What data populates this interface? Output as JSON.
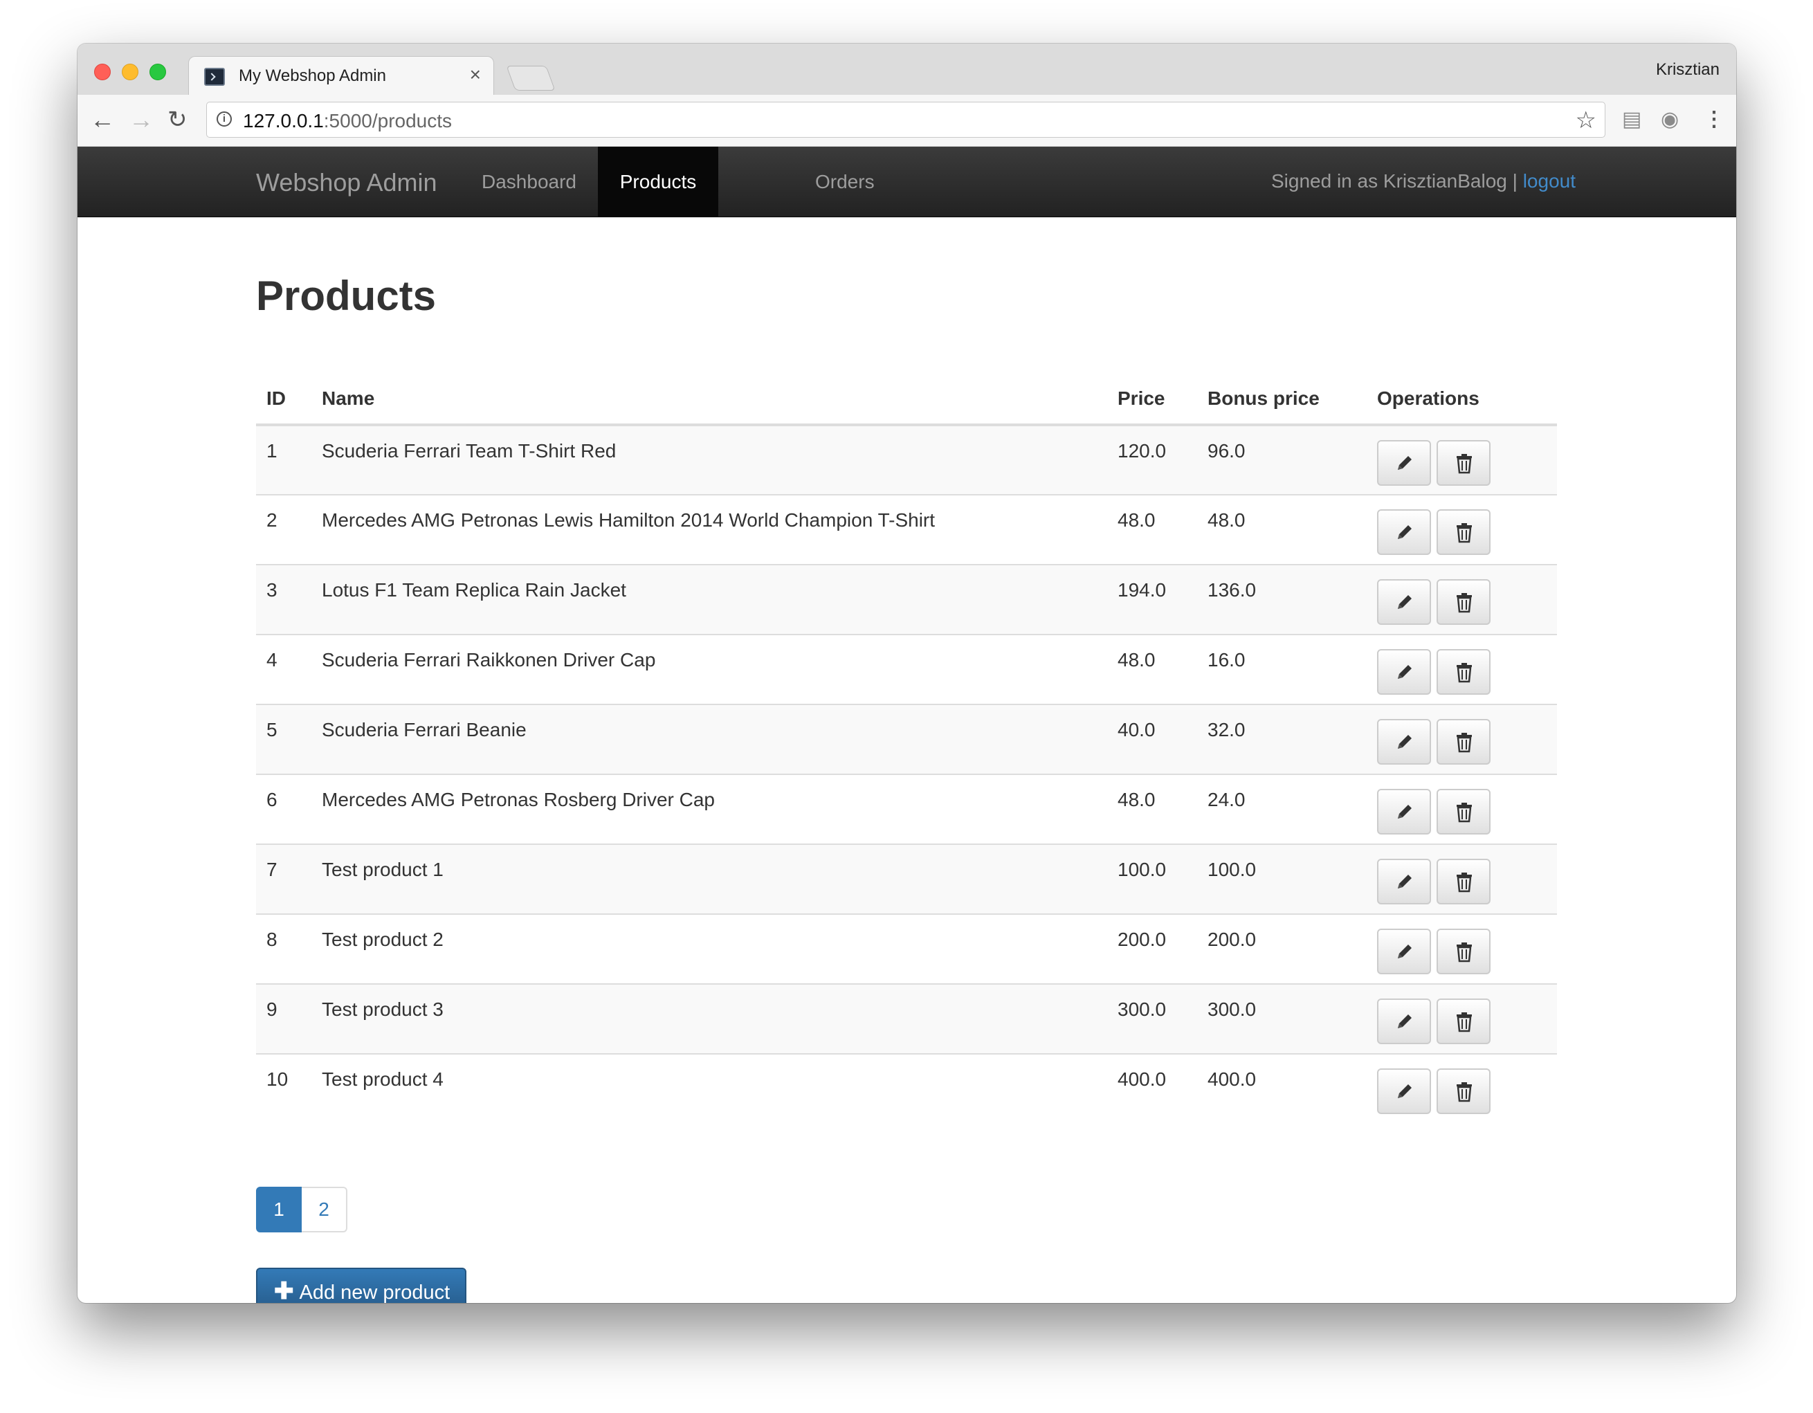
{
  "browser": {
    "tab_title": "My Webshop Admin",
    "tab_close": "×",
    "profile_name": "Krisztian",
    "url_host": "127.0.0.1",
    "url_path": ":5000/products"
  },
  "navbar": {
    "brand": "Webshop Admin",
    "items": [
      {
        "label": "Dashboard",
        "active": false
      },
      {
        "label": "Products",
        "active": true
      },
      {
        "label": "Orders",
        "active": false
      }
    ],
    "signed_in_text": "Signed in as KrisztianBalog | ",
    "logout_label": "logout"
  },
  "page": {
    "title": "Products",
    "columns": [
      "ID",
      "Name",
      "Price",
      "Bonus price",
      "Operations"
    ],
    "rows": [
      {
        "id": "1",
        "name": "Scuderia Ferrari Team T-Shirt Red",
        "price": "120.0",
        "bonus": "96.0"
      },
      {
        "id": "2",
        "name": "Mercedes AMG Petronas Lewis Hamilton 2014 World Champion T-Shirt",
        "price": "48.0",
        "bonus": "48.0"
      },
      {
        "id": "3",
        "name": "Lotus F1 Team Replica Rain Jacket",
        "price": "194.0",
        "bonus": "136.0"
      },
      {
        "id": "4",
        "name": "Scuderia Ferrari Raikkonen Driver Cap",
        "price": "48.0",
        "bonus": "16.0"
      },
      {
        "id": "5",
        "name": "Scuderia Ferrari Beanie",
        "price": "40.0",
        "bonus": "32.0"
      },
      {
        "id": "6",
        "name": "Mercedes AMG Petronas Rosberg Driver Cap",
        "price": "48.0",
        "bonus": "24.0"
      },
      {
        "id": "7",
        "name": "Test product 1",
        "price": "100.0",
        "bonus": "100.0"
      },
      {
        "id": "8",
        "name": "Test product 2",
        "price": "200.0",
        "bonus": "200.0"
      },
      {
        "id": "9",
        "name": "Test product 3",
        "price": "300.0",
        "bonus": "300.0"
      },
      {
        "id": "10",
        "name": "Test product 4",
        "price": "400.0",
        "bonus": "400.0"
      }
    ],
    "pagination": [
      "1",
      "2"
    ],
    "current_page": "1",
    "add_button_label": "Add new product"
  },
  "colors": {
    "primary": "#337ab7",
    "navbar_bg": "#222222",
    "navbar_active": "#080808",
    "link": "#428bca"
  }
}
